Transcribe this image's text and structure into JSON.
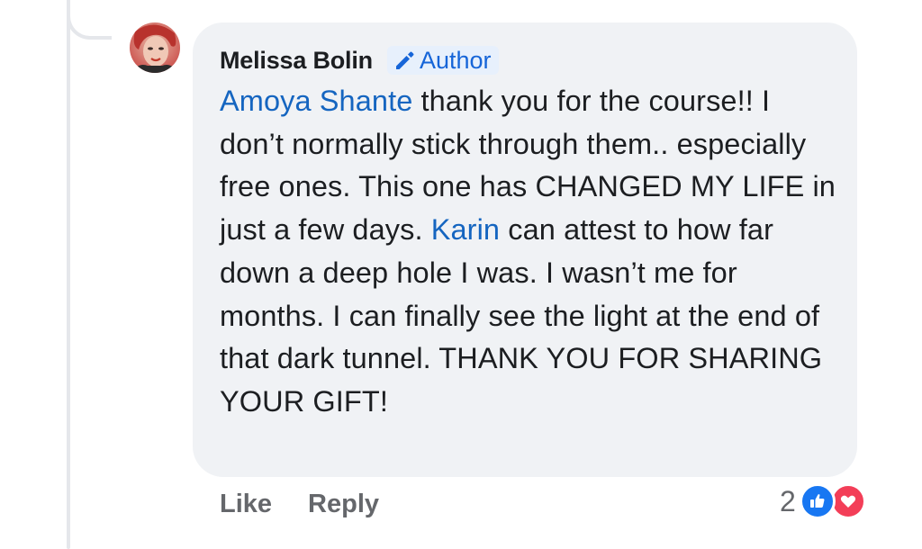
{
  "comment": {
    "author": "Melissa Bolin",
    "badge_label": "Author",
    "text_segments": [
      {
        "type": "mention",
        "text": "Amoya Shante"
      },
      {
        "type": "text",
        "text": " thank you for the course!! I don’t normally stick through them.. especially free ones. This one has CHANGED MY LIFE in just a few days. "
      },
      {
        "type": "mention",
        "text": "Karin"
      },
      {
        "type": "text",
        "text": " can attest to how far down a deep hole I was. I wasn’t me for months. I can finally see the light at the end of that dark tunnel. THANK YOU FOR SHARING YOUR GIFT!"
      }
    ]
  },
  "actions": {
    "like_label": "Like",
    "reply_label": "Reply"
  },
  "reactions": {
    "count": "2",
    "icons": [
      "like-icon",
      "love-icon"
    ]
  },
  "colors": {
    "bubble": "#f0f2f5",
    "mention": "#1565c0",
    "badge_text": "#1665d8",
    "action_text": "#65676b",
    "like_blue": "#1877f2",
    "love_red": "#f33e58"
  }
}
